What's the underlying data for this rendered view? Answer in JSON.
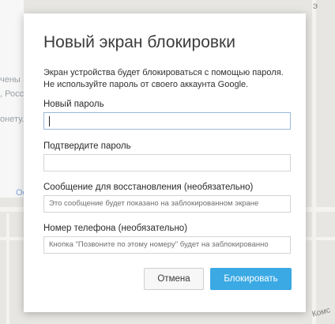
{
  "background": {
    "left_fragments": [
      "чены",
      ", Росс",
      "онету.",
      "Ос"
    ],
    "top_right": "э",
    "bottom_right": "Комс"
  },
  "dialog": {
    "title": "Новый экран блокировки",
    "description": "Экран устройства будет блокироваться с помощью пароля. Не используйте пароль от своего аккаунта Google.",
    "new_password": {
      "label": "Новый пароль",
      "value": ""
    },
    "confirm_password": {
      "label": "Подтвердите пароль",
      "value": ""
    },
    "recovery_message": {
      "label": "Сообщение для восстановления (необязательно)",
      "placeholder": "Это сообщение будет показано на заблокированном экране"
    },
    "phone_number": {
      "label": "Номер телефона (необязательно)",
      "placeholder": "Кнопка \"Позвоните по этому номеру\" будет на заблокированно"
    },
    "cancel_label": "Отмена",
    "lock_label": "Блокировать"
  },
  "colors": {
    "accent": "#3aa9e4",
    "focus_border": "#9ab8da"
  }
}
